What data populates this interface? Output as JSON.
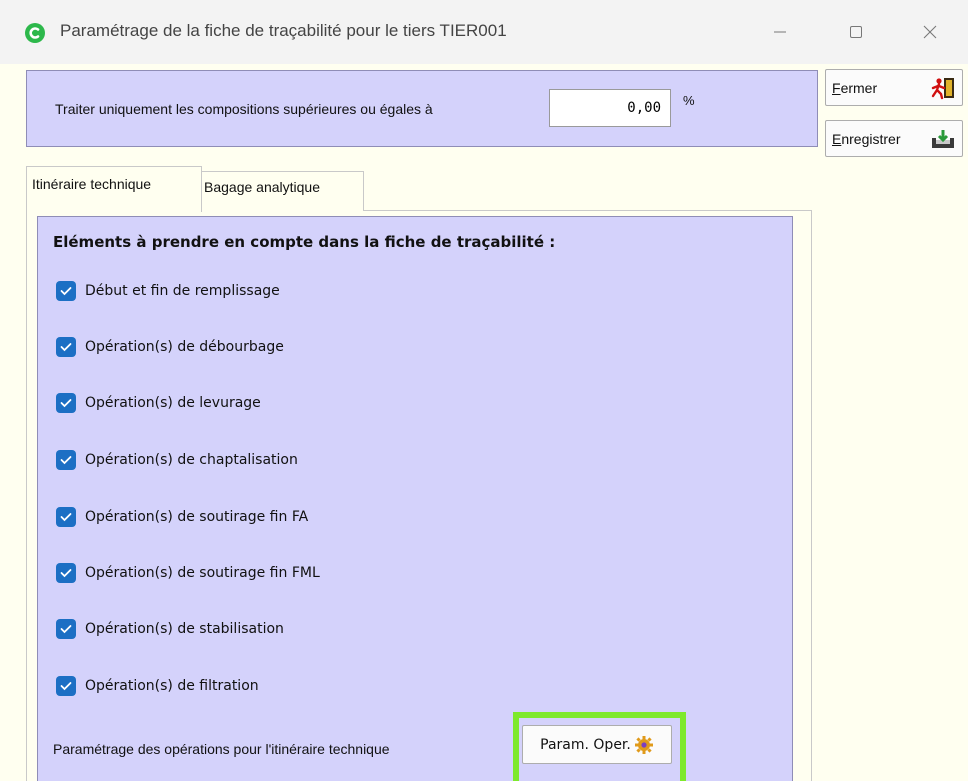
{
  "window": {
    "title": "Paramétrage de la fiche de traçabilité pour le tiers TIER001",
    "minimize": "—",
    "maximize": "☐",
    "close": "✕"
  },
  "threshold": {
    "label": "Traiter uniquement les compositions supérieures ou égales à",
    "value": "0,00",
    "unit": "%"
  },
  "buttons": {
    "close_first": "F",
    "close_rest": "ermer",
    "save_first": "E",
    "save_rest": "nregistrer"
  },
  "tabs": [
    {
      "label": "Itinéraire technique",
      "active": true
    },
    {
      "label": "Bagage analytique",
      "active": false
    }
  ],
  "panel": {
    "heading": "Eléments à prendre en compte dans la fiche de traçabilité :",
    "items": [
      {
        "label": "Début et fin de remplissage",
        "checked": true
      },
      {
        "label": "Opération(s)  de débourbage",
        "checked": true
      },
      {
        "label": "Opération(s)  de levurage",
        "checked": true
      },
      {
        "label": "Opération(s)  de chaptalisation",
        "checked": true
      },
      {
        "label": "Opération(s)  de soutirage fin FA",
        "checked": true
      },
      {
        "label": "Opération(s)  de soutirage fin FML",
        "checked": true
      },
      {
        "label": "Opération(s)  de stabilisation",
        "checked": true
      },
      {
        "label": "Opération(s)  de filtration",
        "checked": true
      }
    ],
    "footer_label": "Paramétrage des opérations pour l'itinéraire technique",
    "param_button": "Param. Oper."
  },
  "colors": {
    "panel_bg": "#d4d2fb",
    "checkbox": "#1c6fc4",
    "highlight": "#7ee92c",
    "app_icon": "#2db84b"
  }
}
